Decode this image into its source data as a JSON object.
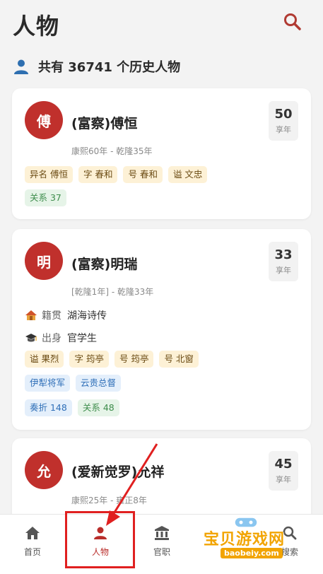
{
  "header": {
    "title": "人物"
  },
  "summary": {
    "text": "共有 36741 个历史人物"
  },
  "persons": [
    {
      "avatar": "傅",
      "name": "(富察)傅恒",
      "years": "康熙60年 - 乾隆35年",
      "age": "50",
      "age_unit": "享年",
      "tags": [
        "异名 傅恒",
        "字 春和",
        "号 春和",
        "谥 文忠"
      ],
      "relation": "关系 37"
    },
    {
      "avatar": "明",
      "name": "(富察)明瑞",
      "years": "[乾隆1年] - 乾隆33年",
      "age": "33",
      "age_unit": "享年",
      "origin_label": "籍贯",
      "origin_value": "湖海诗传",
      "background_label": "出身",
      "background_value": "官学生",
      "tags": [
        "谥 果烈",
        "字 筠亭",
        "号 筠亭",
        "号 北窗"
      ],
      "offices": [
        "伊犁将军",
        "云贵总督"
      ],
      "memorials": "奏折 148",
      "relation": "关系 48"
    },
    {
      "avatar": "允",
      "name": "(爱新觉罗)允祥",
      "years": "康熙25年 - 雍正8年",
      "age": "45",
      "age_unit": "享年"
    }
  ],
  "nav": {
    "home": "首页",
    "people": "人物",
    "offices": "官职",
    "search": "搜索",
    "active": "people"
  },
  "watermark": {
    "main": "宝贝游戏网",
    "sub": "baobeiy.com"
  },
  "colors": {
    "accent": "#c0302c",
    "annotation": "#e02020"
  }
}
